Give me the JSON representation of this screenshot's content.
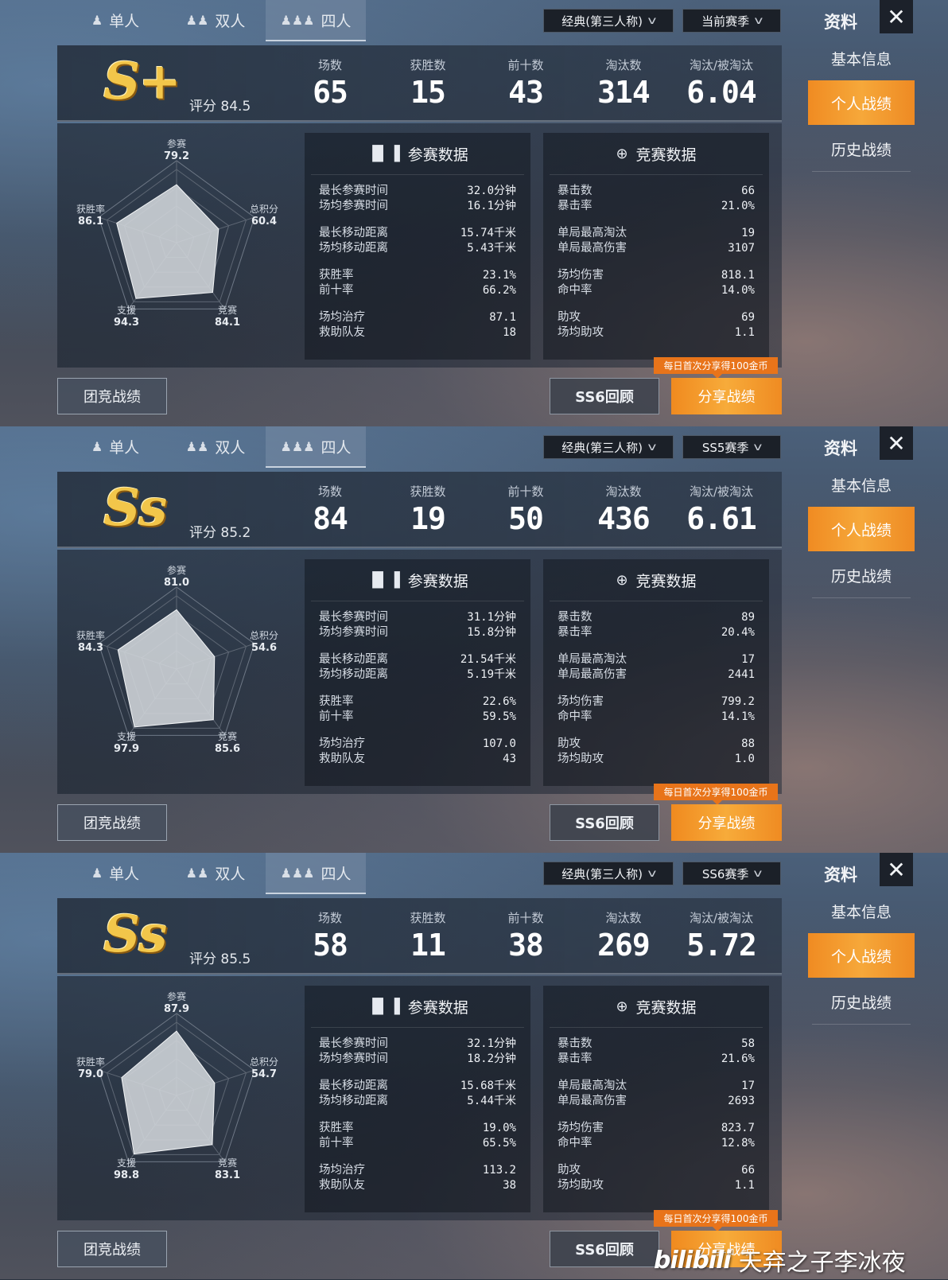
{
  "mode_tabs": [
    {
      "label": "单人",
      "icon": "solo-person-icon"
    },
    {
      "label": "双人",
      "icon": "duo-people-icon"
    },
    {
      "label": "四人",
      "icon": "squad-people-icon"
    }
  ],
  "side_menu": {
    "title": "资料",
    "close": "✕",
    "items": [
      "基本信息",
      "个人战绩",
      "历史战绩"
    ],
    "active_index": 1
  },
  "radar_axes": [
    "参赛",
    "总积分",
    "竞赛",
    "支援",
    "获胜率"
  ],
  "stat_labels": [
    "场数",
    "获胜数",
    "前十数",
    "淘汰数",
    "淘汰/被淘汰"
  ],
  "box_titles": {
    "participation": "参赛数据",
    "competition": "竞赛数据"
  },
  "buttons": {
    "team": "团竞战绩",
    "review": "SS6回顾",
    "share": "分享战绩",
    "promo": "每日首次分享得100金币"
  },
  "accent_colors": {
    "orange": "#f39a2c",
    "promo": "#e8741a",
    "grade_gold": "#f2c64a"
  },
  "panels": [
    {
      "mode": "经典(第三人称)",
      "season": "当前赛季",
      "grade": "S+",
      "score": "评分 84.5",
      "stats": [
        "65",
        "15",
        "43",
        "314",
        "6.04"
      ],
      "radar": {
        "参赛": "79.2",
        "总积分": "60.4",
        "竞赛": "84.1",
        "支援": "94.3",
        "获胜率": "86.1"
      },
      "radar_values": [
        79.2,
        60.4,
        84.1,
        94.3,
        86.1
      ],
      "participation": [
        [
          [
            "最长参赛时间",
            "32.0分钟"
          ],
          [
            "场均参赛时间",
            "16.1分钟"
          ]
        ],
        [
          [
            "最长移动距离",
            "15.74千米"
          ],
          [
            "场均移动距离",
            "5.43千米"
          ]
        ],
        [
          [
            "获胜率",
            "23.1%"
          ],
          [
            "前十率",
            "66.2%"
          ]
        ],
        [
          [
            "场均治疗",
            "87.1"
          ],
          [
            "救助队友",
            "18"
          ]
        ]
      ],
      "competition": [
        [
          [
            "暴击数",
            "66"
          ],
          [
            "暴击率",
            "21.0%"
          ]
        ],
        [
          [
            "单局最高淘汰",
            "19"
          ],
          [
            "单局最高伤害",
            "3107"
          ]
        ],
        [
          [
            "场均伤害",
            "818.1"
          ],
          [
            "命中率",
            "14.0%"
          ]
        ],
        [
          [
            "助攻",
            "69"
          ],
          [
            "场均助攻",
            "1.1"
          ]
        ]
      ]
    },
    {
      "mode": "经典(第三人称)",
      "season": "SS5赛季",
      "grade": "Ss",
      "score": "评分 85.2",
      "stats": [
        "84",
        "19",
        "50",
        "436",
        "6.61"
      ],
      "radar": {
        "参赛": "81.0",
        "总积分": "54.6",
        "竞赛": "85.6",
        "支援": "97.9",
        "获胜率": "84.3"
      },
      "radar_values": [
        81.0,
        54.6,
        85.6,
        97.9,
        84.3
      ],
      "participation": [
        [
          [
            "最长参赛时间",
            "31.1分钟"
          ],
          [
            "场均参赛时间",
            "15.8分钟"
          ]
        ],
        [
          [
            "最长移动距离",
            "21.54千米"
          ],
          [
            "场均移动距离",
            "5.19千米"
          ]
        ],
        [
          [
            "获胜率",
            "22.6%"
          ],
          [
            "前十率",
            "59.5%"
          ]
        ],
        [
          [
            "场均治疗",
            "107.0"
          ],
          [
            "救助队友",
            "43"
          ]
        ]
      ],
      "competition": [
        [
          [
            "暴击数",
            "89"
          ],
          [
            "暴击率",
            "20.4%"
          ]
        ],
        [
          [
            "单局最高淘汰",
            "17"
          ],
          [
            "单局最高伤害",
            "2441"
          ]
        ],
        [
          [
            "场均伤害",
            "799.2"
          ],
          [
            "命中率",
            "14.1%"
          ]
        ],
        [
          [
            "助攻",
            "88"
          ],
          [
            "场均助攻",
            "1.0"
          ]
        ]
      ]
    },
    {
      "mode": "经典(第三人称)",
      "season": "SS6赛季",
      "grade": "Ss",
      "score": "评分 85.5",
      "stats": [
        "58",
        "11",
        "38",
        "269",
        "5.72"
      ],
      "radar": {
        "参赛": "87.9",
        "总积分": "54.7",
        "竞赛": "83.1",
        "支援": "98.8",
        "获胜率": "79.0"
      },
      "radar_values": [
        87.9,
        54.7,
        83.1,
        98.8,
        79.0
      ],
      "participation": [
        [
          [
            "最长参赛时间",
            "32.1分钟"
          ],
          [
            "场均参赛时间",
            "18.2分钟"
          ]
        ],
        [
          [
            "最长移动距离",
            "15.68千米"
          ],
          [
            "场均移动距离",
            "5.44千米"
          ]
        ],
        [
          [
            "获胜率",
            "19.0%"
          ],
          [
            "前十率",
            "65.5%"
          ]
        ],
        [
          [
            "场均治疗",
            "113.2"
          ],
          [
            "救助队友",
            "38"
          ]
        ]
      ],
      "competition": [
        [
          [
            "暴击数",
            "58"
          ],
          [
            "暴击率",
            "21.6%"
          ]
        ],
        [
          [
            "单局最高淘汰",
            "17"
          ],
          [
            "单局最高伤害",
            "2693"
          ]
        ],
        [
          [
            "场均伤害",
            "823.7"
          ],
          [
            "命中率",
            "12.8%"
          ]
        ],
        [
          [
            "助攻",
            "66"
          ],
          [
            "场均助攻",
            "1.1"
          ]
        ]
      ]
    }
  ],
  "watermark": {
    "logo": "bilibili",
    "text": "天弃之子李冰夜"
  }
}
